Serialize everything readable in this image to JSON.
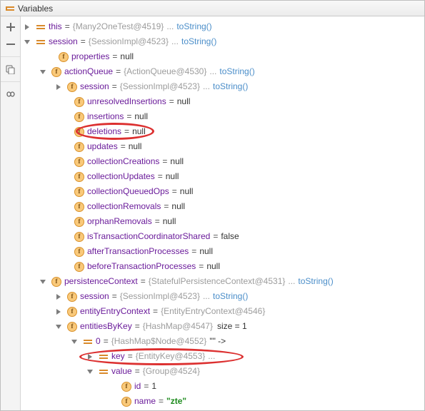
{
  "panel": {
    "title": "Variables"
  },
  "gutter": {
    "add_tip": "Add",
    "remove_tip": "Remove",
    "copy_tip": "Copy",
    "inf_tip": "Infinite"
  },
  "common": {
    "eq": "=",
    "dots": "...",
    "nullv": "null",
    "false": "false",
    "tostring": "toString()"
  },
  "nodes": {
    "this": {
      "name": "this",
      "val": "{Many2OneTest@4519}"
    },
    "session": {
      "name": "session",
      "val": "{SessionImpl@4523}"
    },
    "properties": {
      "name": "properties"
    },
    "actionQueue": {
      "name": "actionQueue",
      "val": "{ActionQueue@4530}"
    },
    "aq_session": {
      "name": "session",
      "val": "{SessionImpl@4523}"
    },
    "unresolvedInsertions": {
      "name": "unresolvedInsertions"
    },
    "insertions": {
      "name": "insertions"
    },
    "deletions": {
      "name": "deletions"
    },
    "updates": {
      "name": "updates"
    },
    "collectionCreations": {
      "name": "collectionCreations"
    },
    "collectionUpdates": {
      "name": "collectionUpdates"
    },
    "collectionQueuedOps": {
      "name": "collectionQueuedOps"
    },
    "collectionRemovals": {
      "name": "collectionRemovals"
    },
    "orphanRemovals": {
      "name": "orphanRemovals"
    },
    "isTransactionCoordinatorShared": {
      "name": "isTransactionCoordinatorShared"
    },
    "afterTransactionProcesses": {
      "name": "afterTransactionProcesses"
    },
    "beforeTransactionProcesses": {
      "name": "beforeTransactionProcesses"
    },
    "persistenceContext": {
      "name": "persistenceContext",
      "val": "{StatefulPersistenceContext@4531}"
    },
    "pc_session": {
      "name": "session",
      "val": "{SessionImpl@4523}"
    },
    "entityEntryContext": {
      "name": "entityEntryContext",
      "val": "{EntityEntryContext@4546}"
    },
    "entitiesByKey": {
      "name": "entitiesByKey",
      "val": "{HashMap@4547}",
      "size_label": "size = 1"
    },
    "entry0": {
      "name": "0",
      "val": "{HashMap$Node@4552}",
      "str": "\"\" ->"
    },
    "key": {
      "name": "key",
      "val": "{EntityKey@4553}"
    },
    "value": {
      "name": "value",
      "val": "{Group@4524}"
    },
    "id": {
      "name": "id",
      "idval": "1"
    },
    "pname": {
      "name": "name",
      "strval": "\"zte\""
    }
  }
}
